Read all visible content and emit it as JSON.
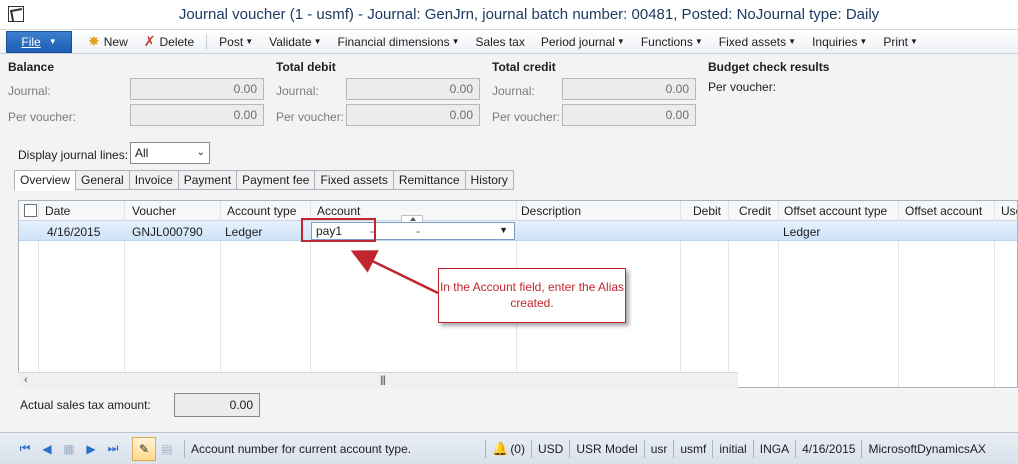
{
  "window": {
    "title": "Journal voucher (1 - usmf) - Journal: GenJrn, journal batch number: 00481, Posted: NoJournal type: Daily"
  },
  "actions": {
    "file": "File",
    "new": "New",
    "delete": "Delete",
    "menus": [
      "Post",
      "Validate",
      "Financial dimensions",
      "Sales tax",
      "Period journal",
      "Functions",
      "Fixed assets",
      "Inquiries",
      "Print"
    ]
  },
  "balance": {
    "heading": "Balance",
    "journal_label": "Journal:",
    "journal_value": "0.00",
    "voucher_label": "Per voucher:",
    "voucher_value": "0.00"
  },
  "total_debit": {
    "heading": "Total debit",
    "journal_label": "Journal:",
    "journal_value": "0.00",
    "voucher_label": "Per voucher:",
    "voucher_value": "0.00"
  },
  "total_credit": {
    "heading": "Total credit",
    "journal_label": "Journal:",
    "journal_value": "0.00",
    "voucher_label": "Per voucher:",
    "voucher_value": "0.00"
  },
  "budget": {
    "heading": "Budget check results",
    "voucher_label": "Per voucher:"
  },
  "display": {
    "label": "Display journal lines:",
    "value": "All"
  },
  "tabs": [
    "Overview",
    "General",
    "Invoice",
    "Payment",
    "Payment fee",
    "Fixed assets",
    "Remittance",
    "History"
  ],
  "grid": {
    "columns": [
      "Date",
      "Voucher",
      "Account type",
      "Account",
      "Description",
      "Debit",
      "Credit",
      "Offset account type",
      "Offset account",
      "Use"
    ],
    "row": {
      "date": "4/16/2015",
      "voucher": "GNJL000790",
      "account_type": "Ledger",
      "account": "pay1",
      "account_segment": "-",
      "account_segment2": "-",
      "offset_account_type": "Ledger"
    }
  },
  "callout": {
    "text": "In the Account field, enter the Alias created."
  },
  "sales_tax": {
    "label": "Actual sales tax amount:",
    "value": "0.00"
  },
  "statusbar": {
    "help": "Account number for current account type.",
    "notifications": "(0)",
    "currency": "USD",
    "model": "USR Model",
    "layer": "usr",
    "company": "usmf",
    "partition": "initial",
    "user": "INGA",
    "date": "4/16/2015",
    "db": "MicrosoftDynamicsAX"
  },
  "colors": {
    "accent": "#1d5fb2",
    "annotation": "#c0262d",
    "selection": "#cfe3f8"
  }
}
